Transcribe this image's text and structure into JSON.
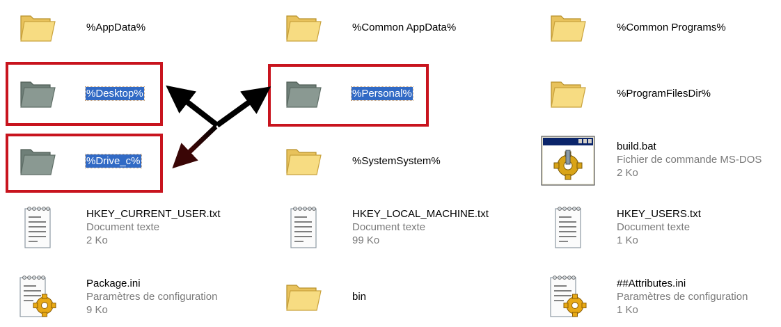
{
  "items": [
    {
      "name": "%AppData%",
      "type": "folder"
    },
    {
      "name": "%Common AppData%",
      "type": "folder"
    },
    {
      "name": "%Common Programs%",
      "type": "folder"
    },
    {
      "name": "%Desktop%",
      "type": "folder-gray",
      "selected": true
    },
    {
      "name": "%Personal%",
      "type": "folder-gray",
      "selected": true
    },
    {
      "name": "%ProgramFilesDir%",
      "type": "folder"
    },
    {
      "name": "%Drive_c%",
      "type": "folder-gray",
      "selected": true
    },
    {
      "name": "%SystemSystem%",
      "type": "folder"
    },
    {
      "name": "build.bat",
      "desc": "Fichier de commande MS-DOS",
      "size": "2 Ko",
      "type": "batch"
    },
    {
      "name": "HKEY_CURRENT_USER.txt",
      "desc": "Document texte",
      "size": "2 Ko",
      "type": "text"
    },
    {
      "name": "HKEY_LOCAL_MACHINE.txt",
      "desc": "Document texte",
      "size": "99 Ko",
      "type": "text"
    },
    {
      "name": "HKEY_USERS.txt",
      "desc": "Document texte",
      "size": "1 Ko",
      "type": "text"
    },
    {
      "name": "Package.ini",
      "desc": "Paramètres de configuration",
      "size": "9 Ko",
      "type": "ini"
    },
    {
      "name": "bin",
      "type": "folder"
    },
    {
      "name": "##Attributes.ini",
      "desc": "Paramètres de configuration",
      "size": "1 Ko",
      "type": "ini"
    }
  ],
  "colors": {
    "highlight_box": "#c8141e",
    "selection": "#316ac5",
    "folder_yellow": "#f7dc82",
    "folder_gray": "#8a9992",
    "secondary_text": "#7a7a7a"
  }
}
